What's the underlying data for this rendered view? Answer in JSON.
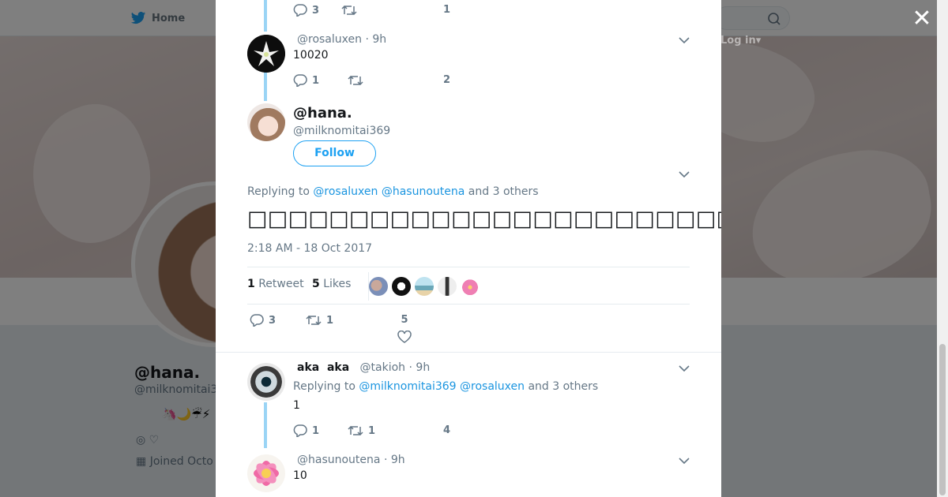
{
  "background": {
    "nav_home": "Home",
    "login": "Log in",
    "profile_name": "@hana.",
    "profile_handle": "@milknomitai3",
    "profile_emoji": "🦄🌙☔⚡",
    "profile_location": "♡",
    "profile_joined": "Joined Octo"
  },
  "modal": {
    "close_label": "✕",
    "prev_tweet": {
      "reply_count": "3",
      "retweet_count": "",
      "like_count": "1"
    },
    "tweet_rosa": {
      "handle": "@rosaluxen",
      "time": "9h",
      "text": "10020",
      "reply_count": "1",
      "retweet_count": "",
      "like_count": "2"
    },
    "main_tweet": {
      "name": "@hana.",
      "handle": "@milknomitai369",
      "follow_label": "Follow",
      "replying_prefix": "Replying to",
      "replying_to": [
        "@rosaluxen",
        "@hasunoutena"
      ],
      "replying_suffix": "and 3 others",
      "text": "□□□□□□□□□□□□□□□□□□□□□□□□□□□□□□□□",
      "timestamp": "2:18 AM - 18 Oct 2017",
      "retweets_num": "1",
      "retweets_label": "Retweet",
      "likes_num": "5",
      "likes_label": "Likes",
      "reply_count": "3",
      "retweet_count": "1",
      "like_count": "5"
    },
    "tweet_aka": {
      "name": "aka  aka",
      "handle": "@takioh",
      "time": "9h",
      "replying_prefix": "Replying to",
      "replying_to": [
        "@milknomitai369",
        "@rosaluxen"
      ],
      "replying_suffix": "and 3 others",
      "text": "1",
      "reply_count": "1",
      "retweet_count": "1",
      "like_count": "4"
    },
    "tweet_hasu": {
      "handle": "@hasunoutena",
      "time": "9h",
      "text": "10"
    }
  },
  "colors": {
    "link": "#1b95e0",
    "thread_line": "#9ad4f5",
    "follow": "#1da1f2"
  }
}
